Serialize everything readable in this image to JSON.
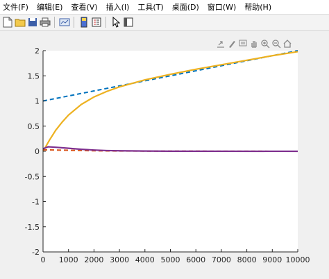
{
  "menu": [
    {
      "label": "文件(F)"
    },
    {
      "label": "编辑(E)"
    },
    {
      "label": "查看(V)"
    },
    {
      "label": "插入(I)"
    },
    {
      "label": "工具(T)"
    },
    {
      "label": "桌面(D)"
    },
    {
      "label": "窗口(W)"
    },
    {
      "label": "帮助(H)"
    }
  ],
  "toolbar_icons": [
    "new-file-icon",
    "open-folder-icon",
    "save-icon",
    "print-icon",
    "link-figure-icon",
    "colorbar-icon",
    "legend-icon",
    "pointer-icon",
    "property-editor-icon"
  ],
  "axes_toolbar_icons": [
    "export-icon",
    "brush-icon",
    "data-tips-icon",
    "pan-icon",
    "zoom-in-icon",
    "zoom-out-icon",
    "home-icon"
  ],
  "colors": {
    "blue": "#0072BD",
    "orange": "#EDB120",
    "red": "#D95319",
    "purple": "#7E2F8E"
  },
  "chart_data": {
    "type": "line",
    "title": "",
    "xlabel": "",
    "ylabel": "",
    "xlim": [
      0,
      10000
    ],
    "ylim": [
      -2,
      2
    ],
    "xticks": [
      0,
      1000,
      2000,
      3000,
      4000,
      5000,
      6000,
      7000,
      8000,
      9000,
      10000
    ],
    "yticks": [
      -2,
      -1.5,
      -1,
      -0.5,
      0,
      0.5,
      1,
      1.5,
      2
    ],
    "grid": false,
    "legend": "none",
    "series": [
      {
        "color": "#0072BD",
        "style": "dashed",
        "x": [
          0,
          10000
        ],
        "y": [
          1.0,
          2.0
        ]
      },
      {
        "color": "#EDB120",
        "style": "solid",
        "x": [
          0,
          250,
          500,
          750,
          1000,
          1500,
          2000,
          2500,
          3000,
          4000,
          5000,
          6000,
          7000,
          8000,
          9000,
          10000
        ],
        "y": [
          0.0,
          0.22,
          0.42,
          0.58,
          0.72,
          0.93,
          1.08,
          1.19,
          1.28,
          1.42,
          1.53,
          1.63,
          1.72,
          1.81,
          1.9,
          1.98
        ]
      },
      {
        "color": "#D95319",
        "style": "dashed",
        "x": [
          0,
          1000,
          2000,
          3000,
          10000
        ],
        "y": [
          0.03,
          0.02,
          0.01,
          0.005,
          0.0
        ]
      },
      {
        "color": "#7E2F8E",
        "style": "solid",
        "x": [
          0,
          200,
          500,
          1000,
          1500,
          2000,
          2500,
          3000,
          4000,
          5000,
          10000
        ],
        "y": [
          0.05,
          0.09,
          0.08,
          0.06,
          0.04,
          0.025,
          0.015,
          0.01,
          0.005,
          0.002,
          0.0
        ]
      }
    ]
  }
}
